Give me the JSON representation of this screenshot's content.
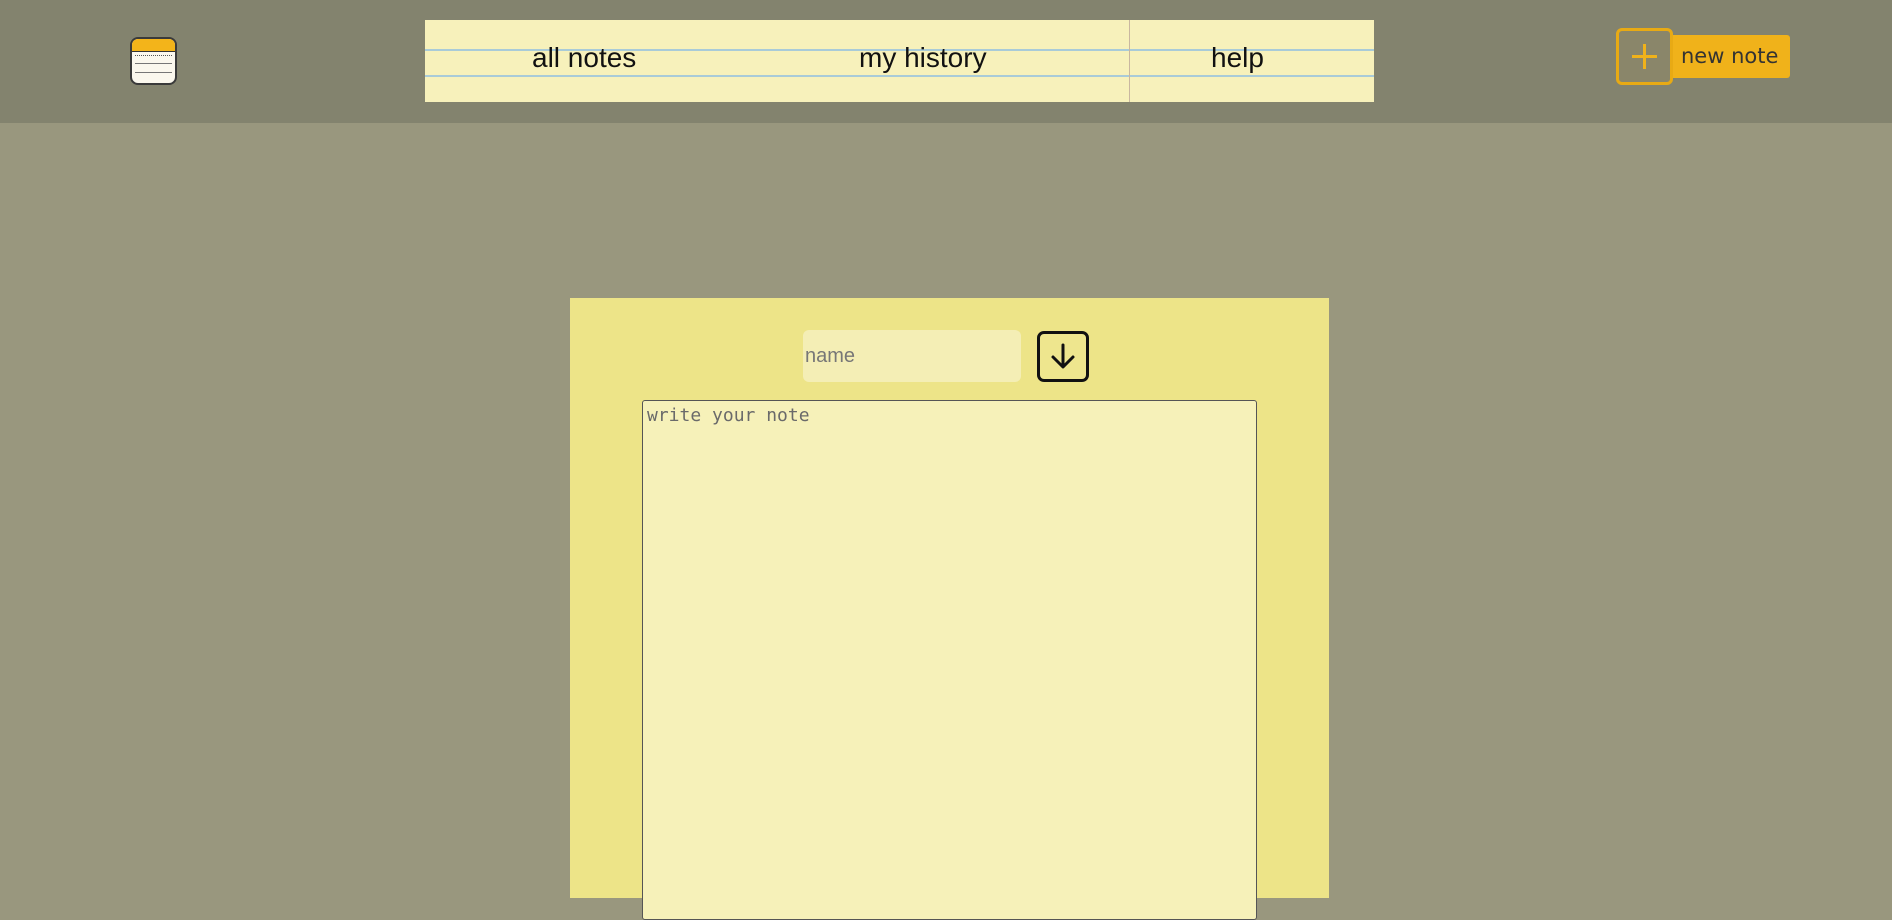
{
  "app": {
    "icon": "notes-pad-icon"
  },
  "nav": {
    "items": [
      {
        "label": "all notes"
      },
      {
        "label": "my history"
      },
      {
        "label": "help"
      }
    ]
  },
  "new_note": {
    "icon": "plus-icon",
    "label": "new note"
  },
  "editor": {
    "name_placeholder": "name",
    "save_icon": "download-save-icon",
    "note_placeholder": "write your note"
  },
  "colors": {
    "header_bg": "#83836e",
    "page_bg": "#99977e",
    "nav_bg": "#f7f1bb",
    "accent": "#f0b21a",
    "panel_bg": "#ede488",
    "field_bg": "#f6f1b9"
  }
}
